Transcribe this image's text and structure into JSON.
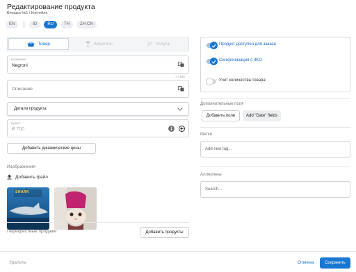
{
  "header": {
    "title": "Редактирование продукта",
    "breadcrumb": "Внешка №1 / Коктейли"
  },
  "languages": [
    {
      "code": "EN",
      "active": false
    },
    {
      "code": "ID",
      "active": false
    },
    {
      "code": "RU",
      "active": true
    },
    {
      "code": "TH",
      "active": false
    },
    {
      "code": "ZH-CN",
      "active": false
    }
  ],
  "tabs": [
    {
      "label": "Товар",
      "icon": "basket-icon",
      "active": true
    },
    {
      "label": "Алкоголь",
      "icon": "cocktail-glass-icon",
      "active": false
    },
    {
      "label": "Услуга",
      "icon": "service-hand-icon",
      "active": false
    }
  ],
  "form": {
    "name_label": "Название*",
    "name_value": "Negroni",
    "name_counter": "7 / 200",
    "description_placeholder": "Описание",
    "details_label": "Детали продукта",
    "price_label": "Цена *",
    "price_placeholder": "₽ 700",
    "dynamic_prices_button": "Добавить динамические цены"
  },
  "images": {
    "section_title": "Изображения",
    "add_file_label": "Добавить файл",
    "thumbnails": [
      {
        "name": "shark-image",
        "caption": "SHARK"
      },
      {
        "name": "cat-in-hat-image"
      }
    ]
  },
  "cross_sales": {
    "title": "Перекрестные продажи",
    "button": "Добавить продукты"
  },
  "right": {
    "toggles": [
      {
        "label": "Продукт доступен для заказа",
        "on": true
      },
      {
        "label": "Синхронизация с IIKO",
        "on": true
      },
      {
        "label": "Учет количества товара",
        "on": false
      }
    ],
    "extra_fields_title": "Дополнительные поля",
    "add_field_button": "Добавить поле",
    "add_date_fields_button": "Add \"Date\" fields",
    "tags_title": "Метки",
    "tags_placeholder": "Add new tag...",
    "allergens_title": "Аллергены",
    "allergens_placeholder": "Search..."
  },
  "footer": {
    "delete": "Удалить",
    "cancel": "Отмена",
    "save": "Сохранить"
  },
  "colors": {
    "accent": "#1976d2"
  }
}
